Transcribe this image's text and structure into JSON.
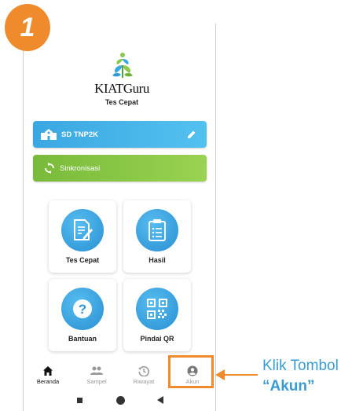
{
  "step_number": "1",
  "app": {
    "name": "KIATGuru",
    "subtitle": "Tes Cepat"
  },
  "school_button": {
    "label": "SD TNP2K",
    "icon": "school-icon",
    "edit_icon": "pencil-icon"
  },
  "sync_button": {
    "label": "Sinkronisasi",
    "icon": "sync-icon"
  },
  "menu": [
    {
      "label": "Tes Cepat",
      "icon": "test-document-icon"
    },
    {
      "label": "Hasil",
      "icon": "clipboard-icon"
    },
    {
      "label": "Bantuan",
      "icon": "help-icon"
    },
    {
      "label": "Pindai QR",
      "icon": "qr-code-icon"
    }
  ],
  "bottom_nav": [
    {
      "label": "Beranda",
      "icon": "home-icon",
      "active": true
    },
    {
      "label": "Sampel",
      "icon": "people-icon",
      "active": false
    },
    {
      "label": "Riwayat",
      "icon": "history-icon",
      "active": false
    },
    {
      "label": "Akun",
      "icon": "account-icon",
      "active": false
    }
  ],
  "callout": {
    "line1": "Klik Tombol",
    "line2": "“Akun”"
  },
  "colors": {
    "accent_orange": "#ef8b2c",
    "primary_blue": "#3aa7e2",
    "sync_green": "#8cc84b",
    "callout_blue": "#3a9bd0"
  }
}
